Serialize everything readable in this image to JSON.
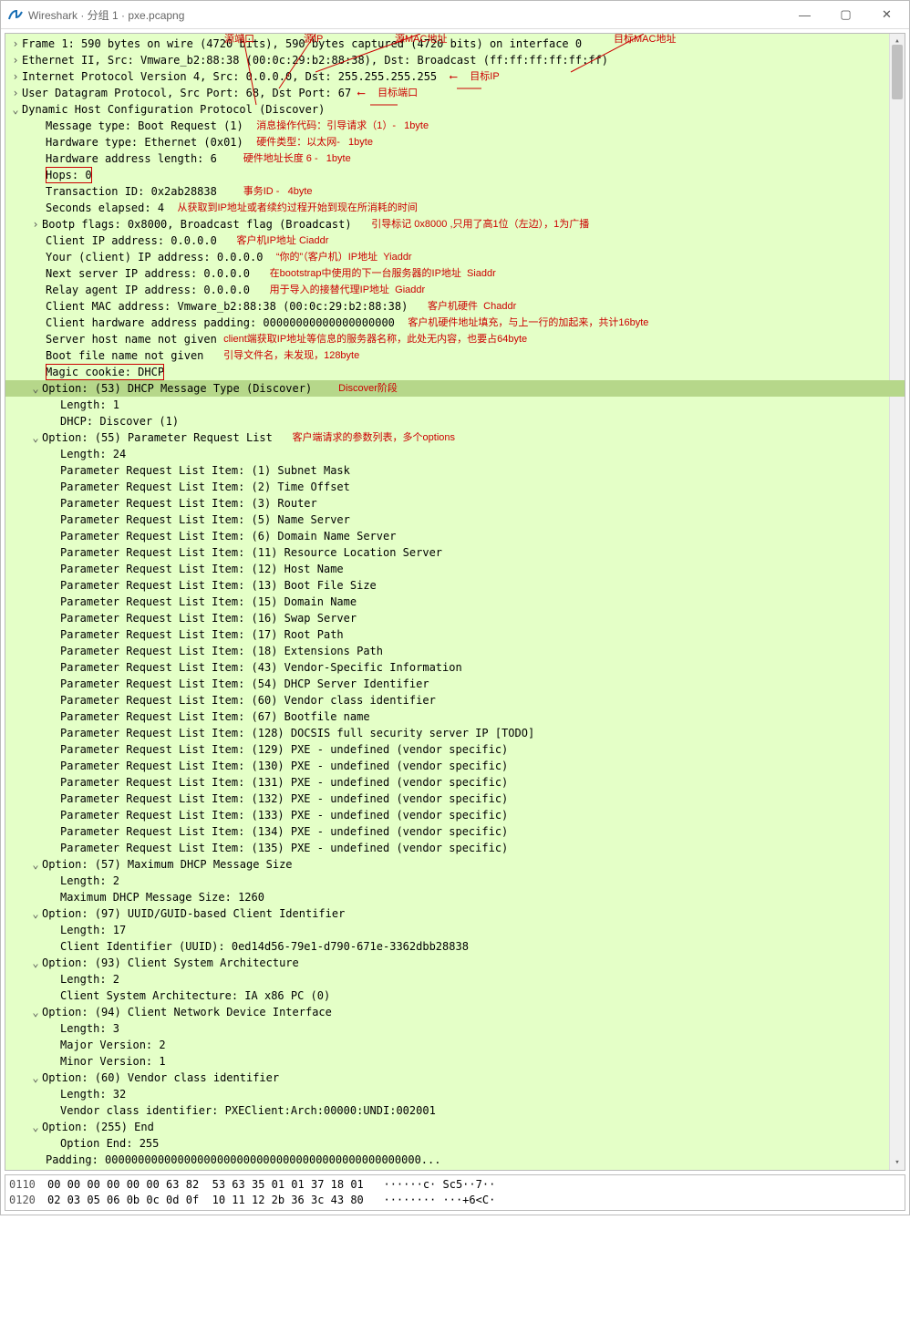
{
  "window": {
    "title": "Wireshark · 分组 1 · pxe.pcapng"
  },
  "top_labels": {
    "src_port": "源端口",
    "src_ip": "源IP",
    "src_mac": "源MAC地址",
    "dst_mac": "目标MAC地址",
    "dst_ip": "目标IP",
    "dst_port": "目标端口"
  },
  "tree": {
    "frame": "Frame 1: 590 bytes on wire (4720 bits), 590 bytes captured (4720 bits) on interface 0",
    "eth": "Ethernet II, Src: Vmware_b2:88:38 (00:0c:29:b2:88:38), Dst: Broadcast (ff:ff:ff:ff:ff:ff)",
    "ip": "Internet Protocol Version 4, Src: 0.0.0.0, Dst: 255.255.255.255",
    "udp": "User Datagram Protocol, Src Port: 68, Dst Port: 67",
    "dhcp": "Dynamic Host Configuration Protocol (Discover)",
    "msg_type": "Message type: Boot Request (1)",
    "msg_type_note": "消息操作代码：引导请求（1）-   1byte",
    "hw_type": "Hardware type: Ethernet (0x01)",
    "hw_type_note": "硬件类型：以太网-   1byte",
    "hw_len": "Hardware address length: 6",
    "hw_len_note": "硬件地址长度 6 -   1byte",
    "hops": "Hops: 0",
    "xid": "Transaction ID: 0x2ab28838",
    "xid_note": "事务ID -   4byte",
    "secs": "Seconds elapsed: 4",
    "secs_note": "从获取到IP地址或者续约过程开始到现在所消耗的时间",
    "flags": "Bootp flags: 0x8000, Broadcast flag (Broadcast)",
    "flags_note": "引导标记 0x8000 ,只用了高1位（左边），1为广播",
    "ciaddr": "Client IP address: 0.0.0.0",
    "ciaddr_note": "客户机IP地址 Ciaddr",
    "yiaddr": "Your (client) IP address: 0.0.0.0",
    "yiaddr_note": "“你的”（客户机）IP地址  Yiaddr",
    "siaddr": "Next server IP address: 0.0.0.0",
    "siaddr_note": "在bootstrap中使用的下一台服务器的IP地址  Siaddr",
    "giaddr": "Relay agent IP address: 0.0.0.0",
    "giaddr_note": "用于导入的接替代理IP地址  Giaddr",
    "chaddr": "Client MAC address: Vmware_b2:88:38 (00:0c:29:b2:88:38)",
    "chaddr_note": "客户机硬件  Chaddr",
    "pad": "Client hardware address padding: 00000000000000000000",
    "pad_note": "客户机硬件地址填充，与上一行的加起来，共计16byte",
    "sname": "Server host name not given",
    "sname_note": "client端获取IP地址等信息的服务器名称，此处无内容，也要占64byte",
    "bfile": "Boot file name not given",
    "bfile_note": "引导文件名，未发现，128byte",
    "magic": "Magic cookie: DHCP",
    "opt53": "Option: (53) DHCP Message Type (Discover)",
    "opt53_note": "Discover阶段",
    "len1": "Length: 1",
    "disc": "DHCP: Discover (1)",
    "opt55": "Option: (55) Parameter Request List",
    "opt55_note": "客户端请求的参数列表，多个options",
    "len24": "Length: 24",
    "prl": [
      "Parameter Request List Item: (1) Subnet Mask",
      "Parameter Request List Item: (2) Time Offset",
      "Parameter Request List Item: (3) Router",
      "Parameter Request List Item: (5) Name Server",
      "Parameter Request List Item: (6) Domain Name Server",
      "Parameter Request List Item: (11) Resource Location Server",
      "Parameter Request List Item: (12) Host Name",
      "Parameter Request List Item: (13) Boot File Size",
      "Parameter Request List Item: (15) Domain Name",
      "Parameter Request List Item: (16) Swap Server",
      "Parameter Request List Item: (17) Root Path",
      "Parameter Request List Item: (18) Extensions Path",
      "Parameter Request List Item: (43) Vendor-Specific Information",
      "Parameter Request List Item: (54) DHCP Server Identifier",
      "Parameter Request List Item: (60) Vendor class identifier",
      "Parameter Request List Item: (67) Bootfile name",
      "Parameter Request List Item: (128) DOCSIS full security server IP [TODO]",
      "Parameter Request List Item: (129) PXE - undefined (vendor specific)",
      "Parameter Request List Item: (130) PXE - undefined (vendor specific)",
      "Parameter Request List Item: (131) PXE - undefined (vendor specific)",
      "Parameter Request List Item: (132) PXE - undefined (vendor specific)",
      "Parameter Request List Item: (133) PXE - undefined (vendor specific)",
      "Parameter Request List Item: (134) PXE - undefined (vendor specific)",
      "Parameter Request List Item: (135) PXE - undefined (vendor specific)"
    ],
    "opt57": "Option: (57) Maximum DHCP Message Size",
    "len2": "Length: 2",
    "max": "Maximum DHCP Message Size: 1260",
    "opt97": "Option: (97) UUID/GUID-based Client Identifier",
    "len17": "Length: 17",
    "uuid": "Client Identifier (UUID): 0ed14d56-79e1-d790-671e-3362dbb28838",
    "opt93": "Option: (93) Client System Architecture",
    "arch": "Client System Architecture: IA x86 PC (0)",
    "opt94": "Option: (94) Client Network Device Interface",
    "len3": "Length: 3",
    "maj": "Major Version: 2",
    "min": "Minor Version: 1",
    "opt60": "Option: (60) Vendor class identifier",
    "len32": "Length: 32",
    "vci": "Vendor class identifier: PXEClient:Arch:00000:UNDI:002001",
    "opt255": "Option: (255) End",
    "end": "Option End: 255",
    "padding": "Padding: 000000000000000000000000000000000000000000000000..."
  },
  "hex": {
    "r1_off": "0110",
    "r1_hex": "00 00 00 00 00 00 63 82  53 63 35 01 01 37 18 01",
    "r1_asc": "······c· Sc5··7··",
    "r2_off": "0120",
    "r2_hex": "02 03 05 06 0b 0c 0d 0f  10 11 12 2b 36 3c 43 80",
    "r2_asc": "········ ···+6<C·"
  }
}
